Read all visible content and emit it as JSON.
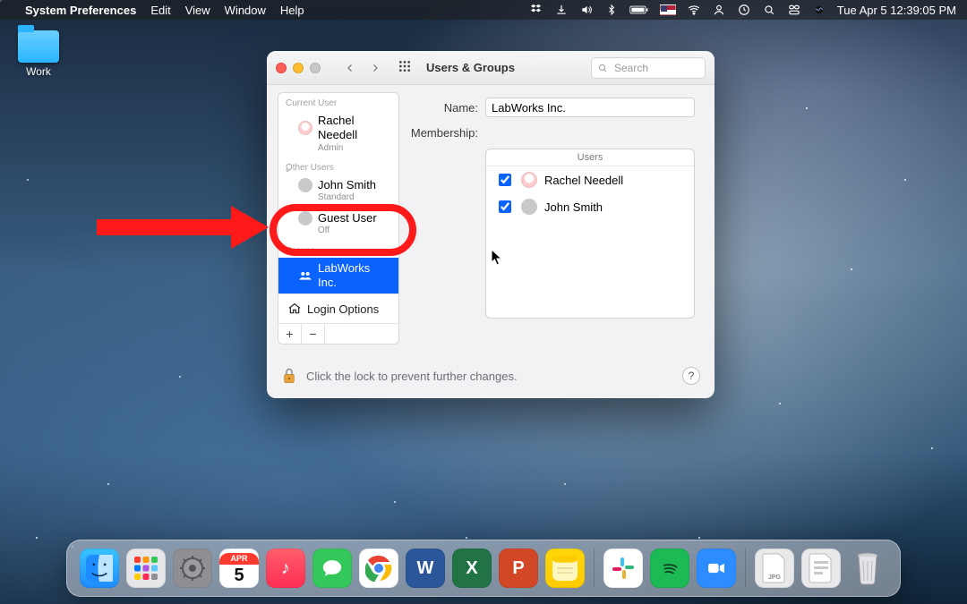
{
  "menubar": {
    "app_name": "System Preferences",
    "menus": [
      "Edit",
      "View",
      "Window",
      "Help"
    ],
    "clock": "Tue Apr 5  12:39:05 PM",
    "status_icons": [
      "dropbox-icon",
      "download-icon",
      "volume-icon",
      "bluetooth-icon",
      "battery-icon",
      "flag-us-icon",
      "wifi-icon",
      "user-icon",
      "clock-alt-icon",
      "search-icon",
      "control-center-icon",
      "siri-icon"
    ]
  },
  "desktop": {
    "icons": [
      {
        "name": "Work",
        "kind": "folder"
      }
    ]
  },
  "window": {
    "title": "Users & Groups",
    "search_placeholder": "Search",
    "sidebar": {
      "section_current_user": "Current User",
      "current_user": {
        "name": "Rachel Needell",
        "role": "Admin"
      },
      "section_other_users": "Other Users",
      "other_users": [
        {
          "name": "John Smith",
          "role": "Standard"
        },
        {
          "name": "Guest User",
          "role": "Off"
        }
      ],
      "section_groups": "Groups",
      "groups": [
        {
          "name": "LabWorks Inc.",
          "selected": true
        }
      ],
      "login_options_label": "Login Options",
      "add_label": "+",
      "remove_label": "−"
    },
    "pane": {
      "name_label": "Name:",
      "name_value": "LabWorks Inc.",
      "membership_label": "Membership:",
      "members_header": "Users",
      "members": [
        {
          "name": "Rachel Needell",
          "checked": true,
          "avatar": "rn"
        },
        {
          "name": "John Smith",
          "checked": true,
          "avatar": "generic"
        }
      ]
    },
    "footer": {
      "lock_text": "Click the lock to prevent further changes.",
      "help_label": "?"
    }
  },
  "dock": {
    "cal_month": "APR",
    "cal_day": "5",
    "items_left": [
      {
        "id": "finder",
        "label": "Finder"
      },
      {
        "id": "launchpad",
        "label": "Launchpad"
      },
      {
        "id": "sysprefs",
        "label": "System Preferences"
      },
      {
        "id": "cal",
        "label": "Calendar"
      },
      {
        "id": "music",
        "label": "Music"
      },
      {
        "id": "messages",
        "label": "Messages"
      },
      {
        "id": "chrome",
        "label": "Google Chrome"
      },
      {
        "id": "word",
        "label": "Microsoft Word"
      },
      {
        "id": "excel",
        "label": "Microsoft Excel"
      },
      {
        "id": "ppt",
        "label": "Microsoft PowerPoint"
      },
      {
        "id": "notes",
        "label": "Notes"
      }
    ],
    "items_right": [
      {
        "id": "slack",
        "label": "Slack"
      },
      {
        "id": "spotify",
        "label": "Spotify"
      },
      {
        "id": "zoom",
        "label": "Zoom"
      }
    ],
    "items_docs": [
      {
        "id": "doc-jpg",
        "label": "JPG"
      },
      {
        "id": "doc-generic",
        "label": "Doc"
      }
    ],
    "trash_label": "Trash"
  }
}
